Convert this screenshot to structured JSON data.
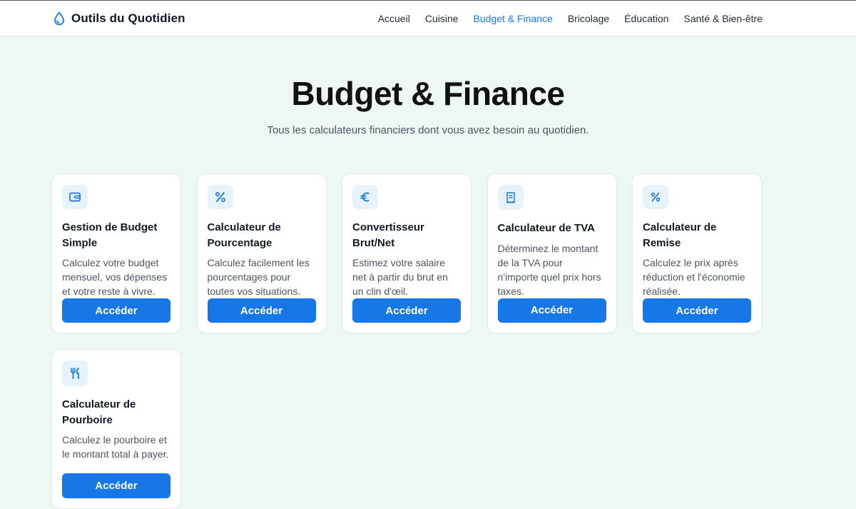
{
  "header": {
    "brand": "Outils du Quotidien",
    "nav": [
      {
        "label": "Accueil",
        "active": false
      },
      {
        "label": "Cuisine",
        "active": false
      },
      {
        "label": "Budget & Finance",
        "active": true
      },
      {
        "label": "Bricolage",
        "active": false
      },
      {
        "label": "Éducation",
        "active": false
      },
      {
        "label": "Santé & Bien-être",
        "active": false
      }
    ]
  },
  "hero": {
    "title": "Budget & Finance",
    "subtitle": "Tous les calculateurs financiers dont vous avez besoin au quotidien."
  },
  "cards": [
    {
      "icon": "wallet-icon",
      "title": "Gestion de Budget Simple",
      "description": "Calculez votre budget mensuel, vos dépenses et votre reste à vivre.",
      "button": "Accéder"
    },
    {
      "icon": "percent-icon",
      "title": "Calculateur de Pourcentage",
      "description": "Calculez facilement les pourcentages pour toutes vos situations.",
      "button": "Accéder"
    },
    {
      "icon": "euro-icon",
      "title": "Convertisseur Brut/Net",
      "description": "Estimez votre salaire net à partir du brut en un clin d'œil.",
      "button": "Accéder"
    },
    {
      "icon": "receipt-icon",
      "title": "Calculateur de TVA",
      "description": "Déterminez le montant de la TVA pour n'importe quel prix hors taxes.",
      "button": "Accéder"
    },
    {
      "icon": "percent-tag-icon",
      "title": "Calculateur de Remise",
      "description": "Calculez le prix après réduction et l'économie réalisée.",
      "button": "Accéder"
    },
    {
      "icon": "utensils-icon",
      "title": "Calculateur de Pourboire",
      "description": "Calculez le pourboire et le montant total à payer.",
      "button": "Accéder"
    }
  ],
  "colors": {
    "accent": "#1877e6",
    "background": "#eef8f2",
    "icon_bg": "#e6f2fc"
  }
}
